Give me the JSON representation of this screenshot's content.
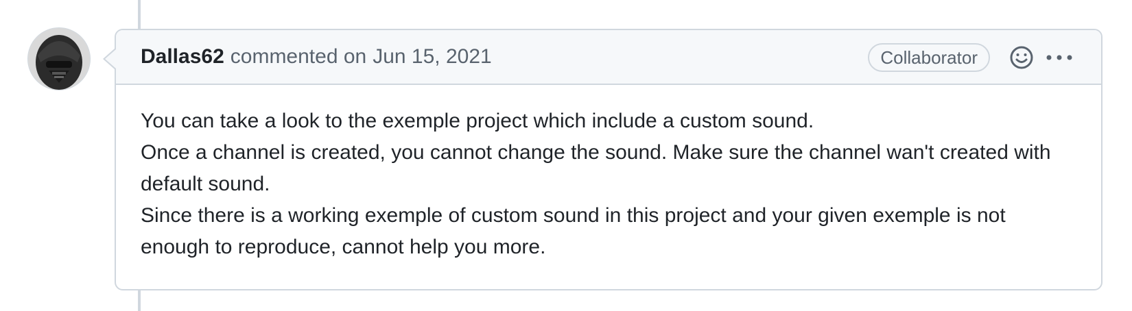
{
  "comment": {
    "author": "Dallas62",
    "action": "commented on",
    "date": "Jun 15, 2021",
    "role_badge": "Collaborator",
    "avatar_icon": "user-avatar",
    "reaction_icon": "smiley-icon",
    "menu_icon": "kebab-horizontal-icon",
    "body": [
      "You can take a look to the exemple project which include a custom sound.",
      "Once a channel is created, you cannot change the sound. Make sure the channel wan't created with default sound.",
      "Since there is a working exemple of custom sound in this project and your given exemple is not enough to reproduce, cannot help you more."
    ]
  },
  "colors": {
    "border": "#d0d7de",
    "header_bg": "#f6f8fa",
    "muted_text": "#59636e",
    "text": "#1f2328"
  }
}
